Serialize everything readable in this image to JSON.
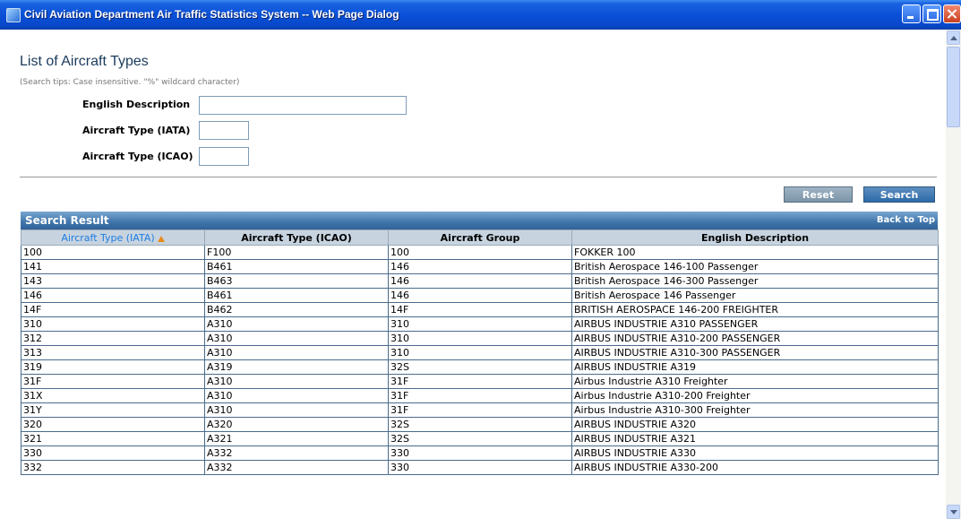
{
  "window": {
    "title": "Civil Aviation Department Air Traffic Statistics System -- Web Page Dialog"
  },
  "page": {
    "title": "List of Aircraft Types",
    "tips": "(Search tips: Case insensitive. \"%\" wildcard character)"
  },
  "form": {
    "english_description_label": "English Description",
    "iata_label": "Aircraft Type (IATA)",
    "icao_label": "Aircraft Type (ICAO)",
    "english_description_value": "",
    "iata_value": "",
    "icao_value": ""
  },
  "buttons": {
    "reset": "Reset",
    "search": "Search"
  },
  "result": {
    "title": "Search Result",
    "back_to_top": "Back to Top",
    "sort_direction": "ascending",
    "columns": [
      "Aircraft Type (IATA)",
      "Aircraft Type (ICAO)",
      "Aircraft Group",
      "English Description"
    ],
    "rows": [
      [
        "100",
        "F100",
        "100",
        "FOKKER 100"
      ],
      [
        "141",
        "B461",
        "146",
        "British Aerospace 146-100 Passenger"
      ],
      [
        "143",
        "B463",
        "146",
        "British Aerospace 146-300 Passenger"
      ],
      [
        "146",
        "B461",
        "146",
        "British Aerospace 146 Passenger"
      ],
      [
        "14F",
        "B462",
        "14F",
        "BRITISH AEROSPACE 146-200 FREIGHTER"
      ],
      [
        "310",
        "A310",
        "310",
        "AIRBUS INDUSTRIE A310 PASSENGER"
      ],
      [
        "312",
        "A310",
        "310",
        "AIRBUS INDUSTRIE A310-200 PASSENGER"
      ],
      [
        "313",
        "A310",
        "310",
        "AIRBUS INDUSTRIE A310-300 PASSENGER"
      ],
      [
        "319",
        "A319",
        "32S",
        "AIRBUS INDUSTRIE A319"
      ],
      [
        "31F",
        "A310",
        "31F",
        "Airbus Industrie A310 Freighter"
      ],
      [
        "31X",
        "A310",
        "31F",
        "Airbus Industrie A310-200 Freighter"
      ],
      [
        "31Y",
        "A310",
        "31F",
        "Airbus Industrie A310-300 Freighter"
      ],
      [
        "320",
        "A320",
        "32S",
        "AIRBUS INDUSTRIE A320"
      ],
      [
        "321",
        "A321",
        "32S",
        "AIRBUS INDUSTRIE A321"
      ],
      [
        "330",
        "A332",
        "330",
        "AIRBUS INDUSTRIE A330"
      ],
      [
        "332",
        "A332",
        "330",
        "AIRBUS INDUSTRIE A330-200"
      ]
    ]
  }
}
